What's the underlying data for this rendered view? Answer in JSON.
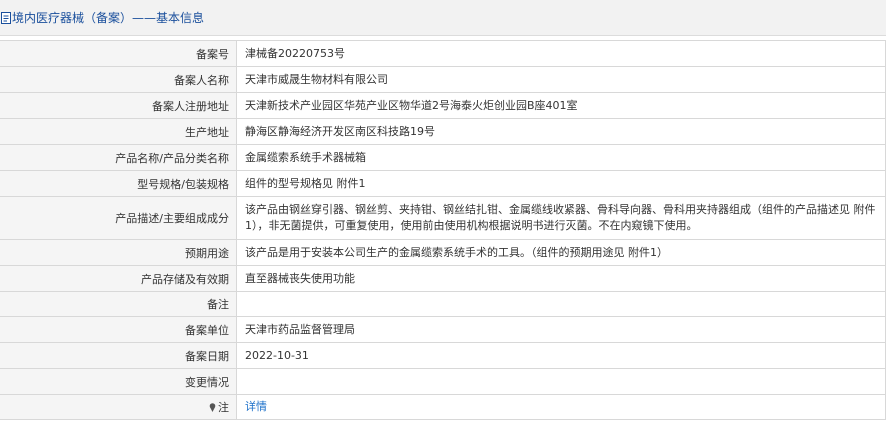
{
  "header": {
    "title": "境内医疗器械（备案）——基本信息"
  },
  "rows": [
    {
      "label": "备案号",
      "value": "津械备20220753号"
    },
    {
      "label": "备案人名称",
      "value": "天津市威晟生物材料有限公司"
    },
    {
      "label": "备案人注册地址",
      "value": "天津新技术产业园区华苑产业区物华道2号海泰火炬创业园B座401室"
    },
    {
      "label": "生产地址",
      "value": "静海区静海经济开发区南区科技路19号"
    },
    {
      "label": "产品名称/产品分类名称",
      "value": "金属缆索系统手术器械箱"
    },
    {
      "label": "型号规格/包装规格",
      "value": "组件的型号规格见 附件1"
    },
    {
      "label": "产品描述/主要组成成分",
      "value": "该产品由钢丝穿引器、钢丝剪、夹持钳、钢丝结扎钳、金属缆线收紧器、骨科导向器、骨科用夹持器组成（组件的产品描述见 附件1），非无菌提供，可重复使用，使用前由使用机构根据说明书进行灭菌。不在内窥镜下使用。"
    },
    {
      "label": "预期用途",
      "value": "该产品是用于安装本公司生产的金属缆索系统手术的工具。（组件的预期用途见 附件1）"
    },
    {
      "label": "产品存储及有效期",
      "value": "直至器械丧失使用功能"
    },
    {
      "label": "备注",
      "value": ""
    },
    {
      "label": "备案单位",
      "value": "天津市药品监督管理局"
    },
    {
      "label": "备案日期",
      "value": "2022-10-31"
    },
    {
      "label": "变更情况",
      "value": ""
    },
    {
      "label": "注",
      "value": "详情"
    }
  ],
  "colors": {
    "header_bg": "#f2f2f2",
    "title": "#1a4f9c",
    "label_bg": "#f5f5f5",
    "border": "#d8d8d8",
    "link": "#1a6fc9"
  }
}
